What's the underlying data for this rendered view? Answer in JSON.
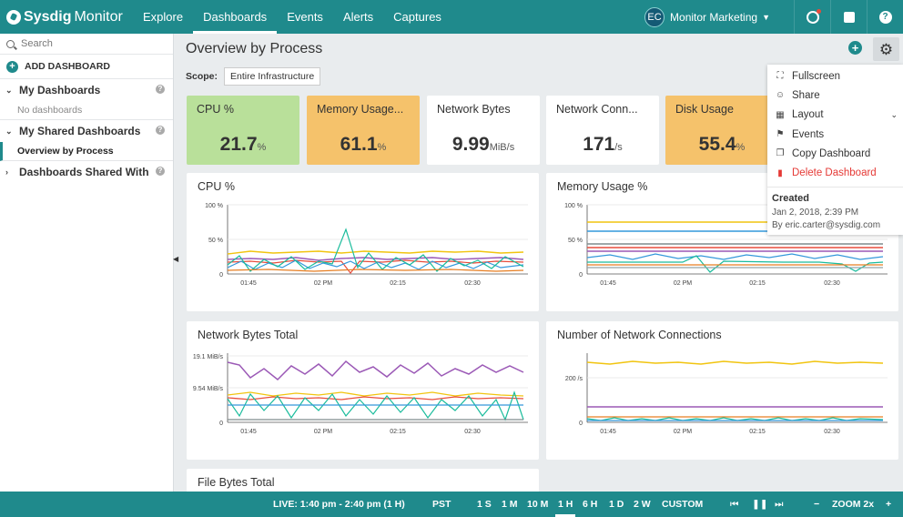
{
  "brand": {
    "name": "Sysdig",
    "product": "Monitor"
  },
  "nav": {
    "links": [
      "Explore",
      "Dashboards",
      "Events",
      "Alerts",
      "Captures"
    ],
    "team_initials": "EC",
    "team_name": "Monitor Marketing"
  },
  "sidebar": {
    "search_placeholder": "Search",
    "add_label": "ADD DASHBOARD",
    "my_dashboards": "My Dashboards",
    "no_dashboards": "No dashboards",
    "my_shared": "My Shared Dashboards",
    "shared_item": "Overview by Process",
    "shared_with": "Dashboards Shared With"
  },
  "page": {
    "title": "Overview by Process",
    "scope_label": "Scope:",
    "scope_value": "Entire Infrastructure"
  },
  "tiles": [
    {
      "title": "CPU %",
      "value": "21.7",
      "unit": "%",
      "color": "#b9e09a"
    },
    {
      "title": "Memory Usage...",
      "value": "61.1",
      "unit": "%",
      "color": "#f5c26b"
    },
    {
      "title": "Network Bytes",
      "value": "9.99",
      "unit": "MiB/s",
      "color": "#ffffff"
    },
    {
      "title": "Network Conn...",
      "value": "171",
      "unit": "/s",
      "color": "#ffffff"
    },
    {
      "title": "Disk Usage",
      "value": "55.4",
      "unit": "%",
      "color": "#f5c26b"
    }
  ],
  "panels": {
    "cpu": {
      "title": "CPU %",
      "yticks": [
        "100 %",
        "50 %",
        "0"
      ],
      "xticks": [
        "01:45",
        "02 PM",
        "02:15",
        "02:30"
      ]
    },
    "mem": {
      "title": "Memory Usage %",
      "yticks": [
        "100 %",
        "50 %",
        "0"
      ],
      "xticks": [
        "01:45",
        "02 PM",
        "02:15",
        "02:30"
      ]
    },
    "net": {
      "title": "Network Bytes Total",
      "yticks": [
        "19.1 MiB/s",
        "9.54 MiB/s",
        "0"
      ],
      "xticks": [
        "01:45",
        "02 PM",
        "02:15",
        "02:30"
      ]
    },
    "conn": {
      "title": "Number of Network Connections",
      "yticks": [
        "200 /s",
        "0"
      ],
      "xticks": [
        "01:45",
        "02 PM",
        "02:15",
        "02:30"
      ]
    },
    "file": {
      "title": "File Bytes Total"
    }
  },
  "menu": {
    "items": [
      {
        "label": "Fullscreen",
        "icon": "fullscreen-icon"
      },
      {
        "label": "Share",
        "icon": "share-icon"
      },
      {
        "label": "Layout",
        "icon": "layout-icon"
      },
      {
        "label": "Events",
        "icon": "events-icon"
      },
      {
        "label": "Copy Dashboard",
        "icon": "copy-icon"
      },
      {
        "label": "Delete Dashboard",
        "icon": "trash-icon"
      }
    ],
    "created_label": "Created",
    "created_date": "Jan 2, 2018, 2:39 PM",
    "created_by": "By eric.carter@sysdig.com"
  },
  "timebar": {
    "live": "LIVE: 1:40 pm - 2:40 pm (1 H)",
    "tz": "PST",
    "ranges": [
      "1 S",
      "1 M",
      "10 M",
      "1 H",
      "6 H",
      "1 D",
      "2 W",
      "CUSTOM"
    ],
    "selected_range": "1 H",
    "zoom_minus": "−",
    "zoom": "ZOOM 2x",
    "zoom_plus": "+"
  },
  "colors": {
    "accent": "#1f8a8c",
    "danger": "#e53935"
  }
}
